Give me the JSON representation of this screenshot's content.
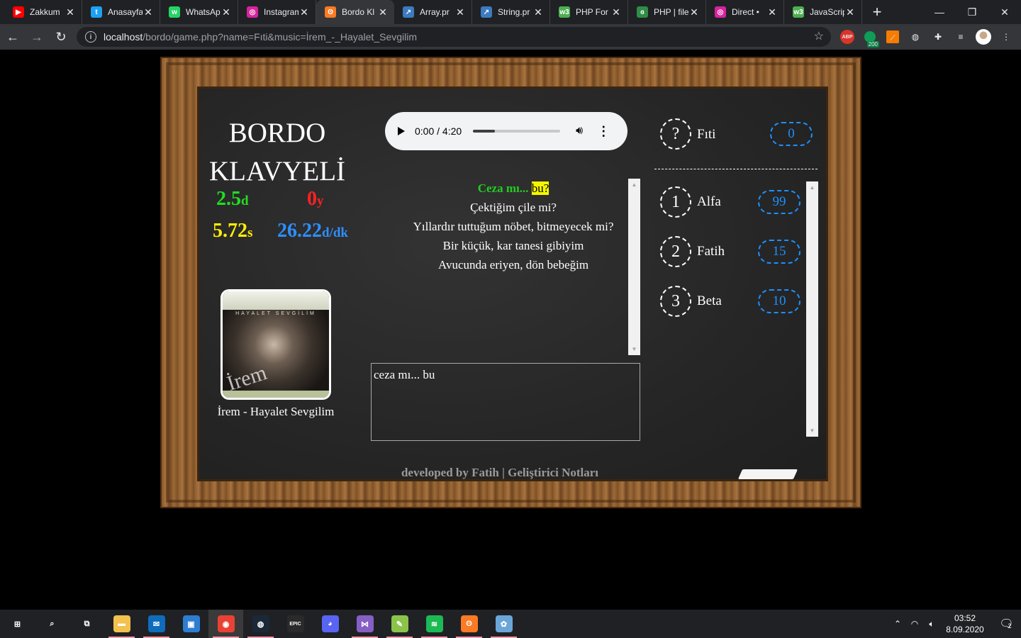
{
  "browser": {
    "tabs": [
      {
        "title": "Zakkum",
        "icon": "youtube-icon",
        "color": "#ff0000",
        "glyph": "▶"
      },
      {
        "title": "Anasayfa",
        "icon": "twitter-icon",
        "color": "#1da1f2",
        "glyph": "t"
      },
      {
        "title": "WhatsApp",
        "icon": "whatsapp-icon",
        "color": "#25d366",
        "glyph": "w"
      },
      {
        "title": "Instagram",
        "icon": "instagram-icon",
        "color": "#d6249f",
        "glyph": "◎"
      },
      {
        "title": "Bordo Kl",
        "icon": "xampp-icon",
        "color": "#fb7a24",
        "glyph": "ʘ"
      },
      {
        "title": "Array.pr",
        "icon": "php-doc-icon",
        "color": "#3b7bbf",
        "glyph": "↗"
      },
      {
        "title": "String.pr",
        "icon": "php-doc-icon",
        "color": "#3b7bbf",
        "glyph": "↗"
      },
      {
        "title": "PHP For",
        "icon": "w3schools-icon",
        "color": "#4caf50",
        "glyph": "w3"
      },
      {
        "title": "PHP | file",
        "icon": "geeks-icon",
        "color": "#2f8d46",
        "glyph": "ɞ"
      },
      {
        "title": "Direct •",
        "icon": "instagram-icon",
        "color": "#d6249f",
        "glyph": "◎"
      },
      {
        "title": "JavaScrip",
        "icon": "w3schools-icon",
        "color": "#4caf50",
        "glyph": "w3"
      }
    ],
    "active_tab": 4,
    "new_tab": "+",
    "url_host": "localhost",
    "url_path": "/bordo/game.php?name=Fıti&music=İrem_-_Hayalet_Sevgilim",
    "abp_label": "ABP",
    "ext_badge": "200"
  },
  "game": {
    "title": "BORDO KLAVYELİ",
    "stats": {
      "correct": {
        "value": "2.5",
        "unit": "d",
        "color": "#22dd22"
      },
      "wrong": {
        "value": "0",
        "unit": "y",
        "color": "#ff2222"
      },
      "time": {
        "value": "5.72",
        "unit": "s",
        "color": "#ffee00"
      },
      "speed": {
        "value": "26.22",
        "unit": "d/dk",
        "color": "#2e8fff"
      }
    },
    "song_name": "İrem - Hayalet Sevgilim",
    "album_band": "HAYALET SEVGİLİM",
    "album_logo": "İrem",
    "player": {
      "time": "0:00 / 4:20",
      "progress": 0.25
    },
    "lyrics": {
      "done_text": "Ceza mı...",
      "current_word": "bu?",
      "lines": [
        "Çektiğim çile mi?",
        "Yıllardır tuttuğum nöbet, bitmeyecek mi?",
        "Bir küçük, kar tanesi gibiyim",
        "Avucunda eriyen, dön bebeğim"
      ]
    },
    "input_value": "ceza mı... bu",
    "me": {
      "rank": "?",
      "name": "Fıti",
      "score": "0"
    },
    "leaderboard": [
      {
        "rank": "1",
        "name": "Alfa",
        "score": "99"
      },
      {
        "rank": "2",
        "name": "Fatih",
        "score": "15"
      },
      {
        "rank": "3",
        "name": "Beta",
        "score": "10"
      }
    ],
    "footer": "developed by Fatih | Geliştirici Notları"
  },
  "taskbar": {
    "apps": [
      {
        "name": "start-icon",
        "glyph": "⊞",
        "color": "#202124"
      },
      {
        "name": "search-icon",
        "glyph": "⌕",
        "color": "#202124"
      },
      {
        "name": "task-view-icon",
        "glyph": "⧉",
        "color": "#202124"
      },
      {
        "name": "file-explorer-icon",
        "glyph": "▬",
        "color": "#f2c14e"
      },
      {
        "name": "mail-icon",
        "glyph": "✉",
        "color": "#0f6cbd"
      },
      {
        "name": "outlook-icon",
        "glyph": "▣",
        "color": "#2d7dd2"
      },
      {
        "name": "chrome-icon",
        "glyph": "◉",
        "color": "#e94235"
      },
      {
        "name": "steam-icon",
        "glyph": "◍",
        "color": "#1b2838"
      },
      {
        "name": "epic-games-icon",
        "glyph": "EPIC",
        "color": "#2a2a2a"
      },
      {
        "name": "discord-icon",
        "glyph": "◕",
        "color": "#5865f2"
      },
      {
        "name": "visual-studio-icon",
        "glyph": "⋈",
        "color": "#865fc5"
      },
      {
        "name": "notepad-plus-icon",
        "glyph": "✎",
        "color": "#8bc34a"
      },
      {
        "name": "spotify-icon",
        "glyph": "≋",
        "color": "#1db954"
      },
      {
        "name": "xampp-icon",
        "glyph": "ʘ",
        "color": "#fb7a24"
      },
      {
        "name": "paint-icon",
        "glyph": "✿",
        "color": "#6aa7d8"
      }
    ],
    "time": "03:52",
    "date": "8.09.2020",
    "notif_count": "2"
  }
}
